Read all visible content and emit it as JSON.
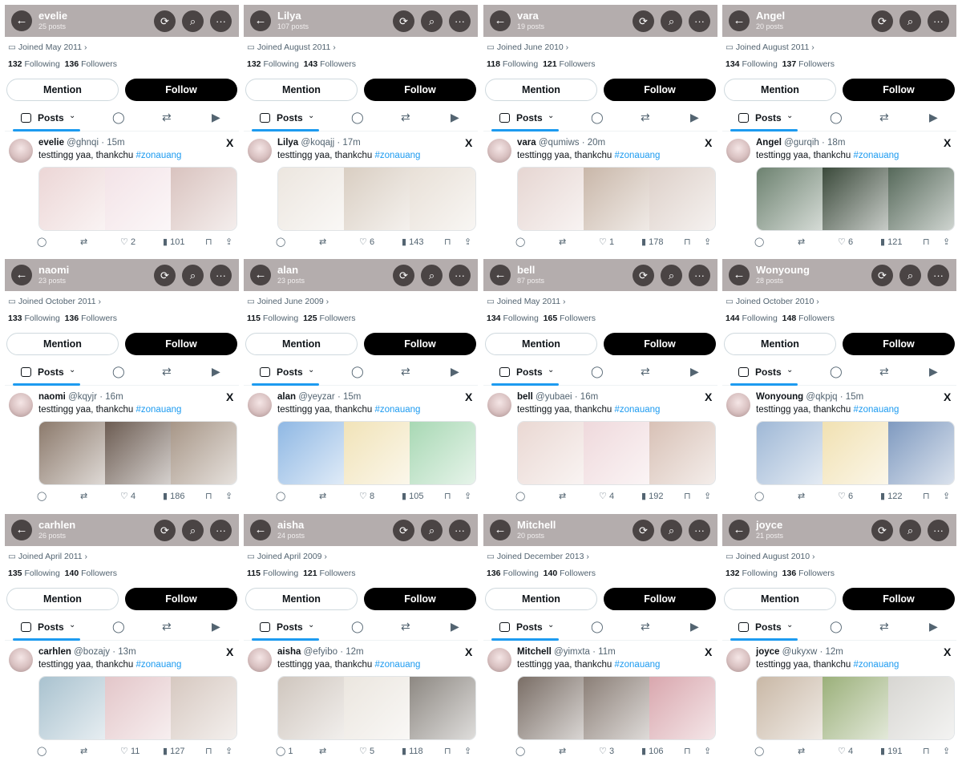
{
  "common": {
    "back_icon": "←",
    "refresh_icon": "⟳",
    "search_icon": "⌕",
    "more_icon": "···",
    "calendar_icon": "▭",
    "chevron_icon": "›",
    "following_label": "Following",
    "followers_label": "Followers",
    "mention_label": "Mention",
    "follow_label": "Follow",
    "posts_tab_label": "Posts",
    "posts_tab_chevron": "⌄",
    "replies_icon": "◯",
    "reposts_icon": "⇄",
    "media_icon": "▶",
    "x_logo": "X",
    "tweet_text": "testtingg yaa, thankchu",
    "hashtag": "#zonauang",
    "reply_icon": "◯",
    "retweet_icon": "⇄",
    "like_icon": "♡",
    "views_icon": "▮",
    "bookmark_icon": "⊓",
    "share_icon": "⇪"
  },
  "profiles": [
    {
      "name": "evelie",
      "posts": "25 posts",
      "joined": "Joined May 2011",
      "following": "132",
      "followers": "136",
      "handle": "@ghnqi",
      "time": "· 15m",
      "replies": "",
      "retweets": "",
      "likes": "2",
      "views": "101",
      "colors": [
        "#ecd6d6",
        "#f3e3e7",
        "#d9c3bf"
      ]
    },
    {
      "name": "Lilya",
      "posts": "107 posts",
      "joined": "Joined August 2011",
      "following": "132",
      "followers": "143",
      "handle": "@koqajj",
      "time": "· 17m",
      "replies": "",
      "retweets": "",
      "likes": "6",
      "views": "143",
      "colors": [
        "#ece6df",
        "#d9cec2",
        "#e8e0d7"
      ]
    },
    {
      "name": "vara",
      "posts": "19 posts",
      "joined": "Joined June 2010",
      "following": "118",
      "followers": "121",
      "handle": "@qumiws",
      "time": "· 20m",
      "replies": "",
      "retweets": "",
      "likes": "1",
      "views": "178",
      "colors": [
        "#e6d6d2",
        "#c9b7a9",
        "#ddd0c9"
      ]
    },
    {
      "name": "Angel",
      "posts": "20 posts",
      "joined": "Joined August 2011",
      "following": "134",
      "followers": "137",
      "handle": "@gurqih",
      "time": "· 18m",
      "replies": "",
      "retweets": "",
      "likes": "6",
      "views": "121",
      "colors": [
        "#6d8270",
        "#3b4a3b",
        "#56695a"
      ]
    },
    {
      "name": "naomi",
      "posts": "23 posts",
      "joined": "Joined October 2011",
      "following": "133",
      "followers": "136",
      "handle": "@kqyjr",
      "time": "· 16m",
      "replies": "",
      "retweets": "",
      "likes": "4",
      "views": "186",
      "colors": [
        "#8c7a6c",
        "#6c5c52",
        "#a79687"
      ]
    },
    {
      "name": "alan",
      "posts": "23 posts",
      "joined": "Joined June 2009",
      "following": "115",
      "followers": "125",
      "handle": "@yeyzar",
      "time": "· 15m",
      "replies": "",
      "retweets": "",
      "likes": "8",
      "views": "105",
      "colors": [
        "#8fb8e4",
        "#f1e3b8",
        "#a8d8b4"
      ]
    },
    {
      "name": "bell",
      "posts": "87 posts",
      "joined": "Joined May 2011",
      "following": "134",
      "followers": "165",
      "handle": "@yubaei",
      "time": "· 16m",
      "replies": "",
      "retweets": "",
      "likes": "4",
      "views": "192",
      "colors": [
        "#ead8d3",
        "#efd9dc",
        "#d8c1b6"
      ]
    },
    {
      "name": "Wonyoung",
      "posts": "28 posts",
      "joined": "Joined October 2010",
      "following": "144",
      "followers": "148",
      "handle": "@qkpjq",
      "time": "· 15m",
      "replies": "",
      "retweets": "",
      "likes": "6",
      "views": "122",
      "colors": [
        "#9fb8d6",
        "#f1e1b2",
        "#7f9ac0"
      ]
    },
    {
      "name": "carhlen",
      "posts": "26 posts",
      "joined": "Joined April 2011",
      "following": "135",
      "followers": "140",
      "handle": "@bozajy",
      "time": "· 13m",
      "replies": "",
      "retweets": "",
      "likes": "11",
      "views": "127",
      "colors": [
        "#a9c2cf",
        "#e3c6c9",
        "#d6c8c0"
      ]
    },
    {
      "name": "aisha",
      "posts": "24 posts",
      "joined": "Joined April 2009",
      "following": "115",
      "followers": "121",
      "handle": "@efyibo",
      "time": "· 12m",
      "replies": "1",
      "retweets": "",
      "likes": "5",
      "views": "118",
      "colors": [
        "#cfc6be",
        "#ebe6df",
        "#8d8882"
      ]
    },
    {
      "name": "Mitchell",
      "posts": "20 posts",
      "joined": "Joined December 2013",
      "following": "136",
      "followers": "140",
      "handle": "@yimxta",
      "time": "· 11m",
      "replies": "",
      "retweets": "",
      "likes": "3",
      "views": "106",
      "colors": [
        "#7a6e66",
        "#8b7f77",
        "#d9a7ae"
      ]
    },
    {
      "name": "joyce",
      "posts": "21 posts",
      "joined": "Joined August 2010",
      "following": "132",
      "followers": "136",
      "handle": "@ukyxw",
      "time": "· 12m",
      "replies": "",
      "retweets": "",
      "likes": "4",
      "views": "191",
      "colors": [
        "#c9b8a6",
        "#9bb07a",
        "#d7d6d2"
      ]
    }
  ]
}
